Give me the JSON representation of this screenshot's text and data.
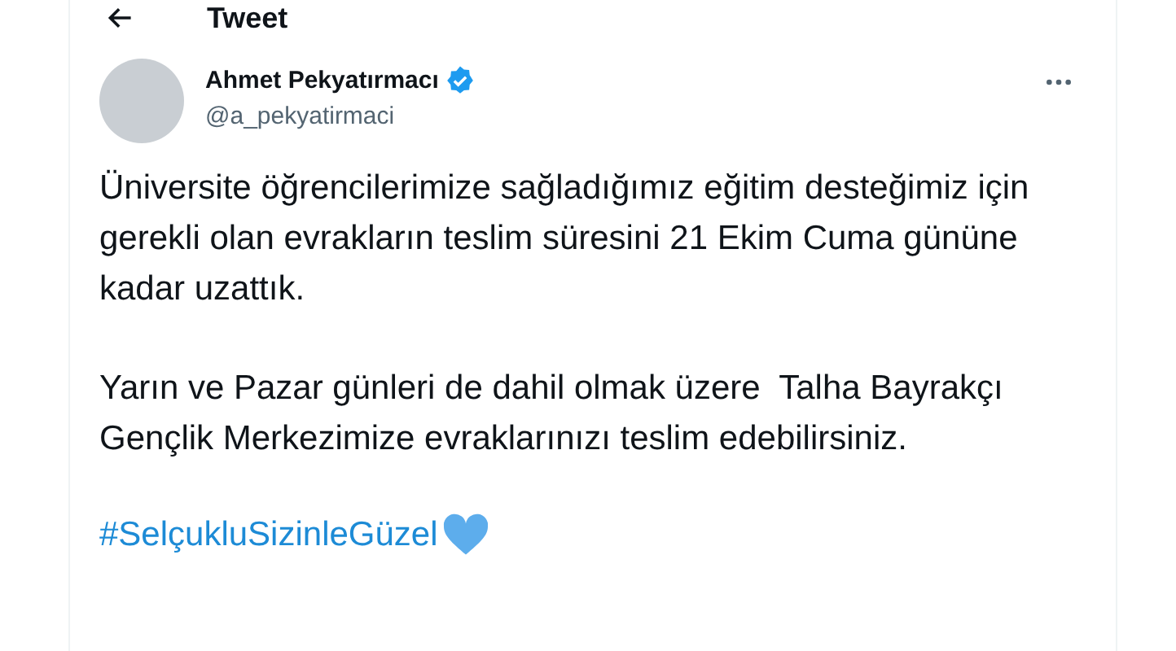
{
  "header": {
    "title": "Tweet"
  },
  "tweet": {
    "author": "Ahmet Pekyatırmacı",
    "verified": true,
    "handle": "@a_pekyatirmaci",
    "paragraphs": [
      "Üniversite öğrencilerimize sağladığımız eğitim desteğimiz için gerekli olan evrakların teslim süresini 21 Ekim Cuma gününe kadar uzattık.",
      "Yarın ve Pazar günleri de dahil olmak üzere  Talha Bayrakçı Gençlik Merkezimize evraklarınızı teslim edebilirsiniz."
    ],
    "hashtag": "#SelçukluSizinleGüzel"
  }
}
